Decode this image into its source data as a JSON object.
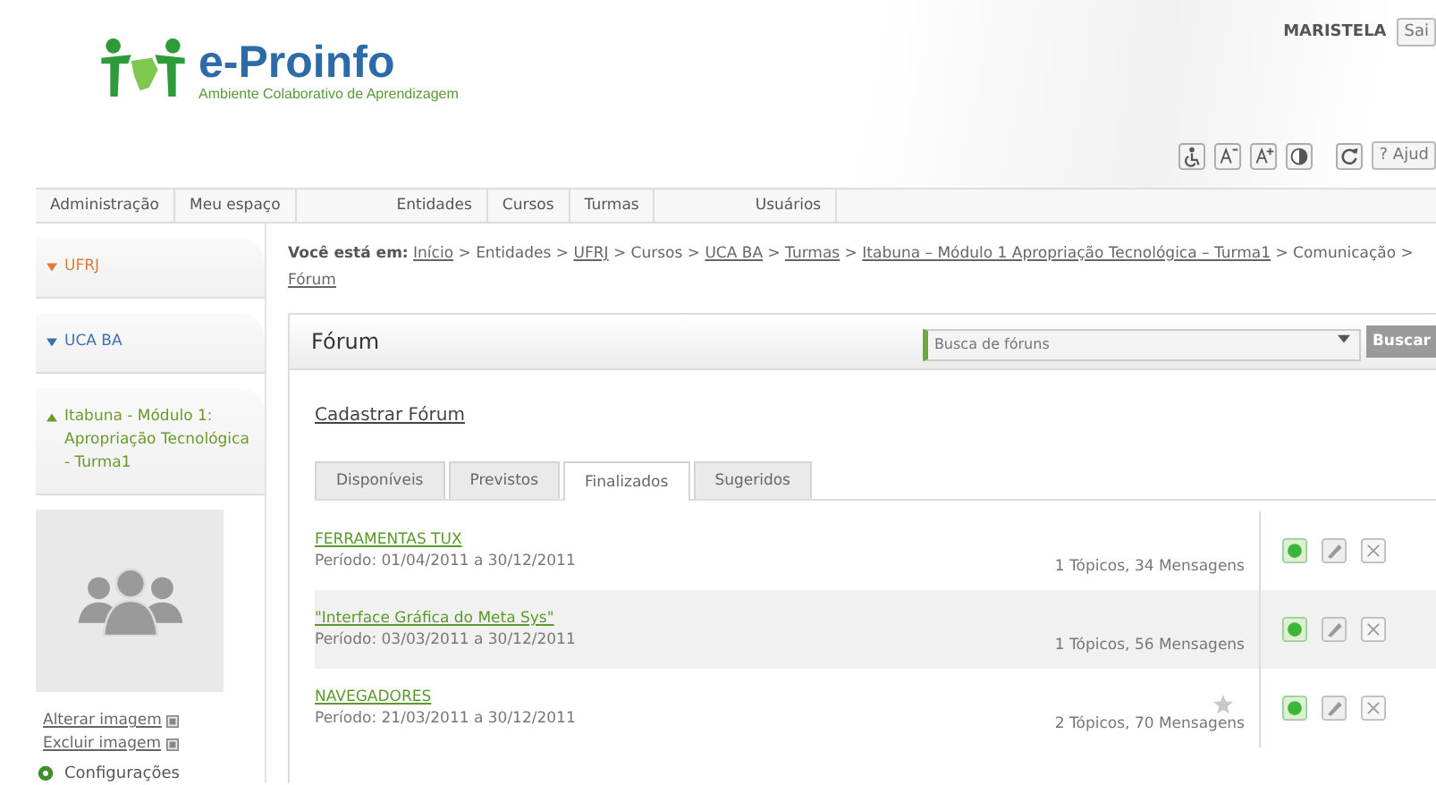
{
  "header": {
    "logo_title": "e-Proinfo",
    "logo_subtitle": "Ambiente Colaborativo de Aprendizagem",
    "user": "MARISTELA",
    "logout": "Sai",
    "help": "? Ajud"
  },
  "nav": [
    "Administração",
    "Meu espaço",
    "Entidades",
    "Cursos",
    "Turmas",
    "Usuários"
  ],
  "sidebar": {
    "items": [
      {
        "label": "UFRJ",
        "expanded": false,
        "color": "#e07b39"
      },
      {
        "label": "UCA BA",
        "expanded": false,
        "color": "#3b6fb0"
      },
      {
        "label": "Itabuna - Módulo 1: Apropriação Tecnológica - Turma1",
        "expanded": true,
        "color": "#6a9a2a"
      }
    ],
    "links": [
      "Alterar imagem",
      "Excluir imagem"
    ],
    "settings": "Configurações"
  },
  "breadcrumb": {
    "label": "Você está em:",
    "separator": ">",
    "path": [
      {
        "text": "Início",
        "link": true
      },
      {
        "text": "Entidades",
        "link": false
      },
      {
        "text": "UFRJ",
        "link": true
      },
      {
        "text": "Cursos",
        "link": false
      },
      {
        "text": "UCA BA",
        "link": true
      },
      {
        "text": "Turmas",
        "link": true
      },
      {
        "text": "Itabuna – Módulo 1 Apropriação Tecnológica – Turma1",
        "link": true
      },
      {
        "text": "Comunicação",
        "link": false
      },
      {
        "text": "Fórum",
        "link": true
      }
    ]
  },
  "panel": {
    "title": "Fórum",
    "search": {
      "placeholder": "Busca de fóruns"
    },
    "search_button": "Buscar",
    "create_link": "Cadastrar Fórum",
    "tabs": [
      {
        "label": "Disponíveis",
        "selected": false
      },
      {
        "label": "Previstos",
        "selected": false
      },
      {
        "label": "Finalizados",
        "selected": true
      },
      {
        "label": "Sugeridos",
        "selected": false
      }
    ],
    "rows": [
      {
        "title": "FERRAMENTAS TUX",
        "period": "Período: 01/04/2011 a 30/12/2011",
        "stats": "1 Tópicos, 34 Mensagens",
        "starred": false
      },
      {
        "title": "\"Interface Gráfica do Meta Sys\"",
        "period": "Período: 03/03/2011 a 30/12/2011",
        "stats": "1 Tópicos, 56 Mensagens",
        "starred": false
      },
      {
        "title": "NAVEGADORES",
        "period": "Período: 21/03/2011 a 30/12/2011",
        "stats": "2 Tópicos, 70 Mensagens",
        "starred": true
      }
    ]
  }
}
